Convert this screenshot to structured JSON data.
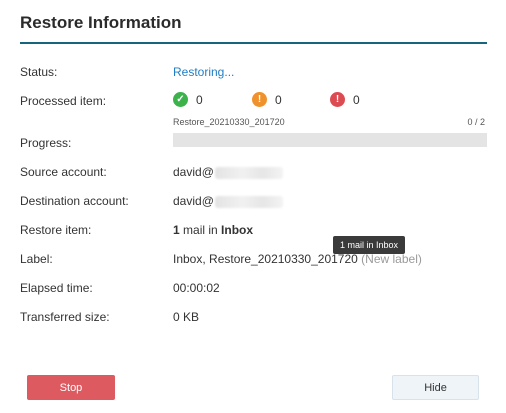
{
  "dialog": {
    "title": "Restore Information"
  },
  "status": {
    "label": "Status:",
    "value": "Restoring..."
  },
  "processed": {
    "label": "Processed item:",
    "success_count": "0",
    "warning_count": "0",
    "error_count": "0",
    "task_name": "Restore_20210330_201720",
    "counter": "0 / 2"
  },
  "progress": {
    "label": "Progress:",
    "percent": 0
  },
  "source": {
    "label": "Source account:",
    "value": "david@"
  },
  "destination": {
    "label": "Destination account:",
    "value": "david@"
  },
  "restore_item": {
    "label": "Restore item:",
    "count": "1",
    "middle": " mail in ",
    "folder": "Inbox"
  },
  "label_row": {
    "label": "Label:",
    "value": "Inbox, Restore_20210330_201720",
    "note": "(New label)"
  },
  "elapsed": {
    "label": "Elapsed time:",
    "value": "00:00:02"
  },
  "transferred": {
    "label": "Transferred size:",
    "value": "0 KB"
  },
  "tooltip": {
    "text": "1 mail in Inbox"
  },
  "buttons": {
    "stop": "Stop",
    "hide": "Hide"
  },
  "icons": {
    "success": "check-circle-icon",
    "warning": "warning-circle-icon",
    "error": "error-circle-icon"
  },
  "colors": {
    "accent": "#17647d",
    "link": "#1f7ec4",
    "success": "#3bb34a",
    "warning": "#f0922b",
    "error": "#dd4b52",
    "stop": "#dd5a60"
  }
}
